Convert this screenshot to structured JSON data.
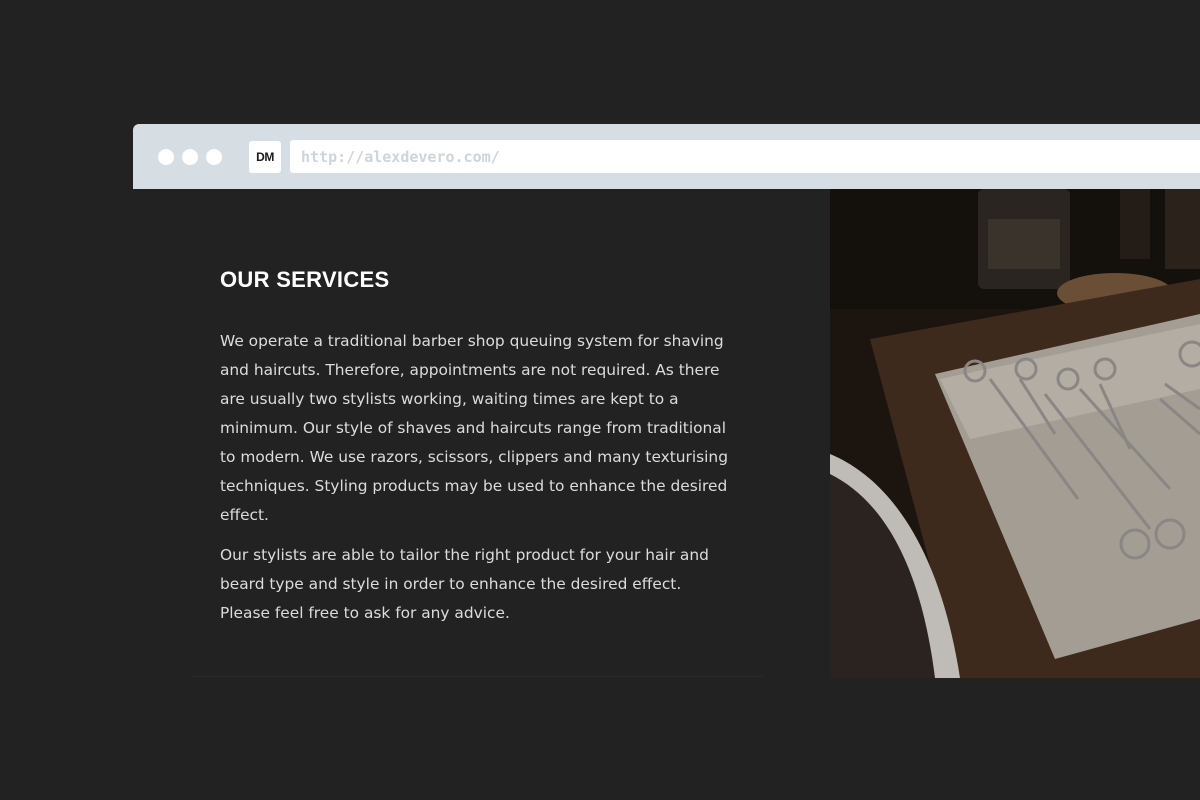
{
  "browser": {
    "url": "http://alexdevero.com/",
    "favicon_text": "DM"
  },
  "section": {
    "title": "OUR SERVICES",
    "paragraphs": [
      "We operate a traditional barber shop queuing system for shaving and haircuts. Therefore, appointments are not required. As there are usually two stylists working, waiting times are kept to a minimum. Our style of shaves and haircuts range from traditional to modern. We use razors, scissors, clippers and many texturising techniques. Styling products may be used to enhance the desired effect.",
      "Our stylists are able to tailor the right product for your hair and beard type and style in order to enhance the desired effect. Please feel free to ask for any advice."
    ]
  },
  "colors": {
    "background": "#222222",
    "browser_chrome": "#d6dde3",
    "heading": "#ffffff",
    "body_text": "#dcdcdc"
  }
}
